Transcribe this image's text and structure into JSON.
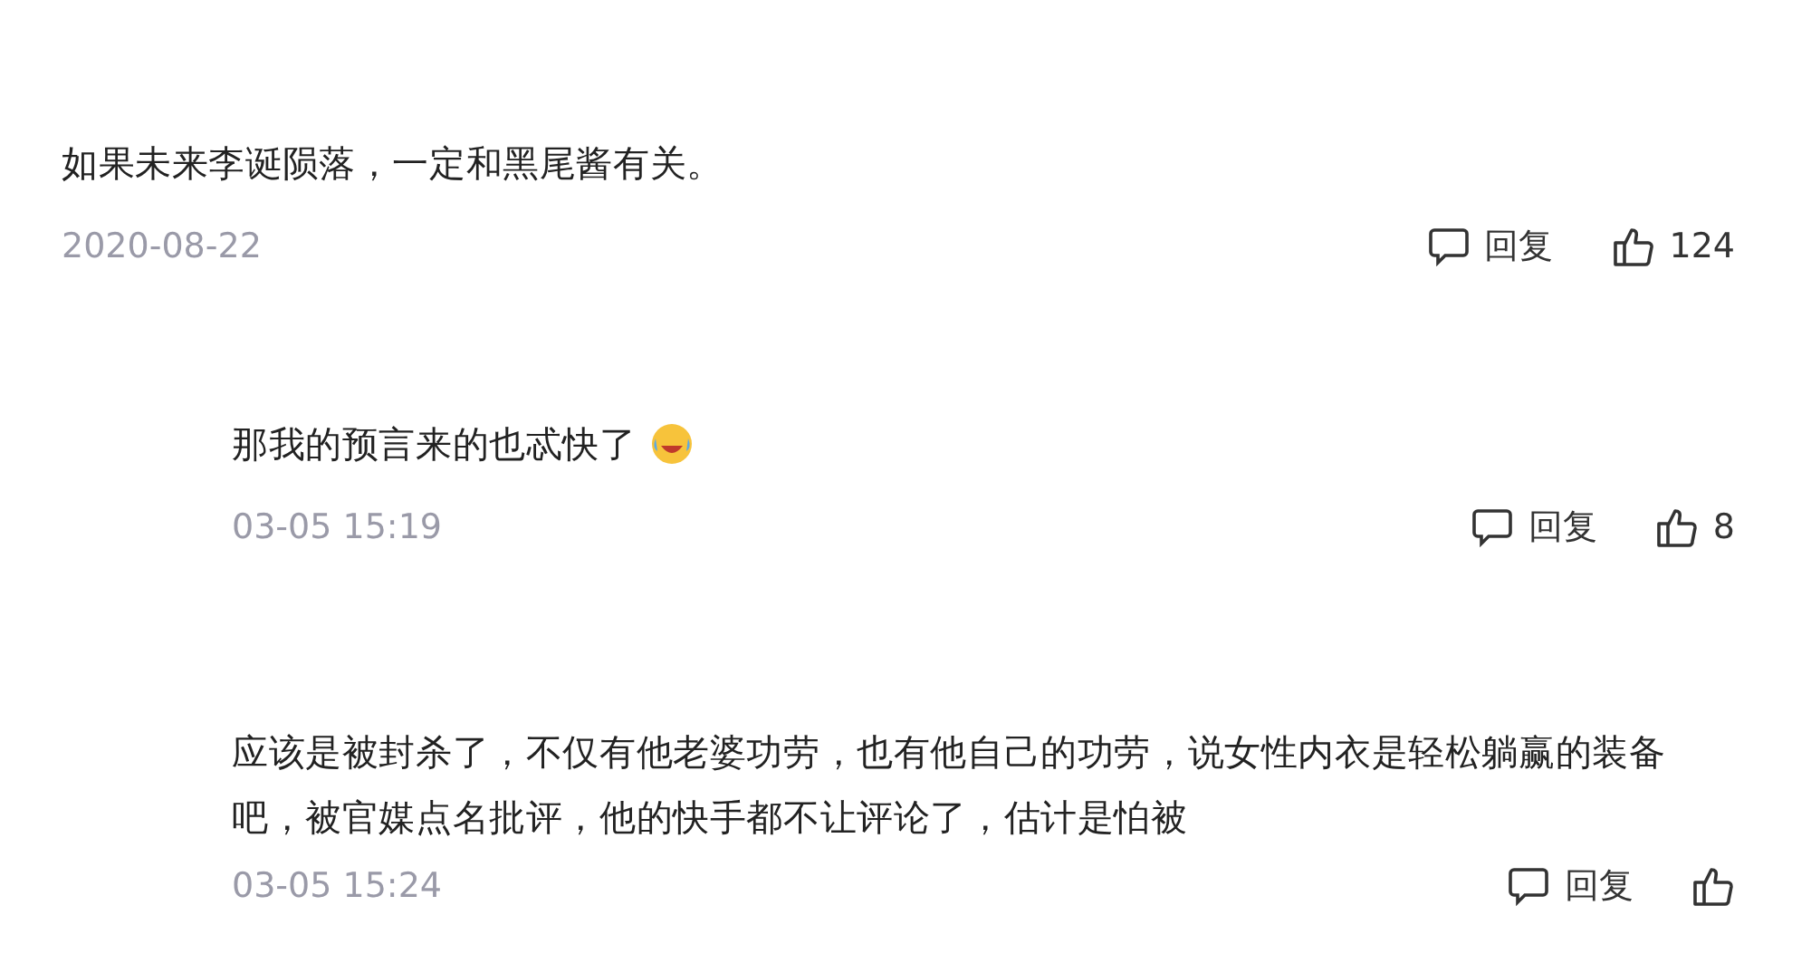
{
  "comments": [
    {
      "kind": "top",
      "text": "如果未来李诞陨落，一定和黑尾酱有关。",
      "emoji": false,
      "time": "2020-08-22",
      "reply_label": "回复",
      "likes": "124"
    },
    {
      "kind": "reply",
      "text": "那我的预言来的也忒快了",
      "emoji": true,
      "time": "03-05 15:19",
      "reply_label": "回复",
      "likes": "8"
    },
    {
      "kind": "reply",
      "text": "应该是被封杀了，不仅有他老婆功劳，也有他自己的功劳，说女性内衣是轻松躺赢的装备吧，被官媒点名批评，他的快手都不让评论了，估计是怕被",
      "emoji": false,
      "time": "03-05 15:24",
      "reply_label": "回复"
    }
  ]
}
